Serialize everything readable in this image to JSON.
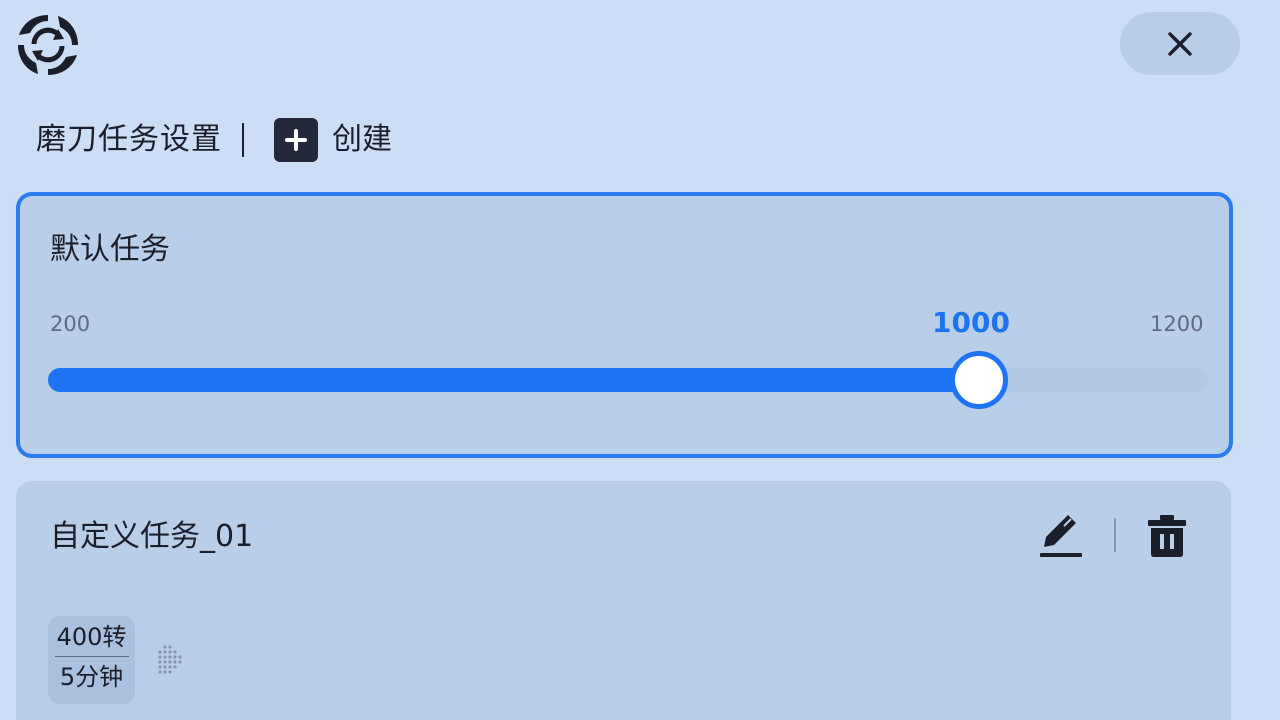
{
  "app": {
    "logo_icon": "app-logo-icon"
  },
  "window": {
    "close_icon": "close-icon"
  },
  "header": {
    "title": "磨刀任务设置",
    "create_label": "创建",
    "create_icon": "plus-icon"
  },
  "default_task": {
    "title": "默认任务",
    "slider": {
      "min": "200",
      "max": "1200",
      "value": "1000",
      "fill_fraction": 0.8
    },
    "accent_color": "#1f74f5"
  },
  "custom_tasks": [
    {
      "title": "自定义任务_01",
      "edit_icon": "edit-icon",
      "delete_icon": "trash-icon",
      "steps": [
        {
          "speed": "400转",
          "duration": "5分钟"
        }
      ]
    }
  ],
  "colors": {
    "background": "#cbdef5",
    "card": "#b9cfe9",
    "accent": "#1f74f5",
    "text": "#1b1e2b"
  }
}
